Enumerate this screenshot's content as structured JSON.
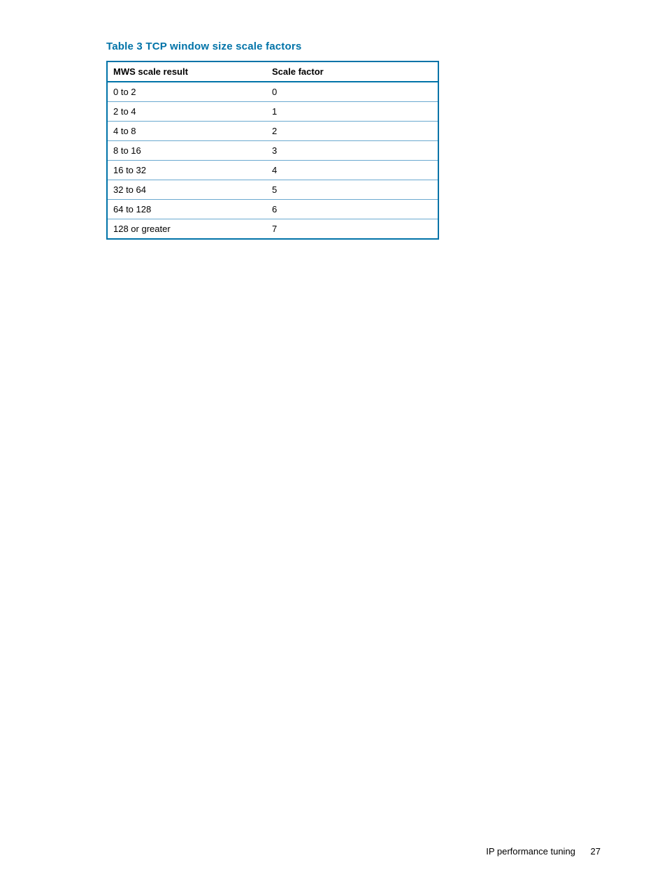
{
  "table": {
    "caption": "Table 3 TCP window size scale factors",
    "headers": [
      "MWS scale result",
      "Scale factor"
    ],
    "rows": [
      [
        "0 to 2",
        "0"
      ],
      [
        "2 to 4",
        "1"
      ],
      [
        "4 to 8",
        "2"
      ],
      [
        "8 to 16",
        "3"
      ],
      [
        "16 to 32",
        "4"
      ],
      [
        "32 to 64",
        "5"
      ],
      [
        "64 to 128",
        "6"
      ],
      [
        "128 or greater",
        "7"
      ]
    ]
  },
  "footer": {
    "title": "IP performance tuning",
    "page": "27"
  }
}
